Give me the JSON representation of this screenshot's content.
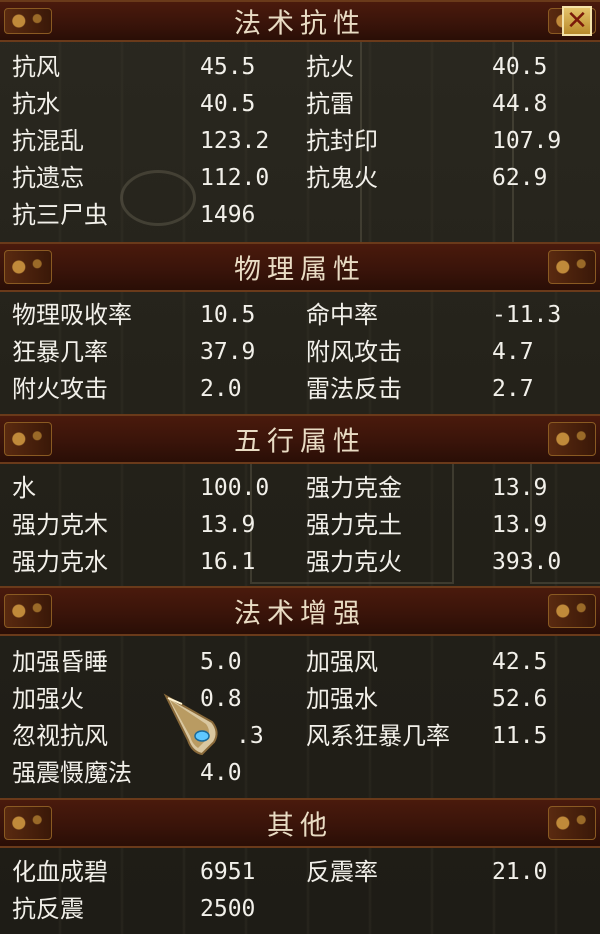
{
  "close_icon": "close-icon",
  "sections": [
    {
      "title": "法术抗性",
      "rows": [
        [
          "抗风",
          "45.5",
          "抗火",
          "40.5"
        ],
        [
          "抗水",
          "40.5",
          "抗雷",
          "44.8"
        ],
        [
          "抗混乱",
          "123.2",
          "抗封印",
          "107.9"
        ],
        [
          "抗遗忘",
          "112.0",
          "抗鬼火",
          "62.9"
        ],
        [
          "抗三尸虫",
          "1496",
          "",
          ""
        ]
      ]
    },
    {
      "title": "物理属性",
      "rows": [
        [
          "物理吸收率",
          "10.5",
          "命中率",
          "-11.3"
        ],
        [
          "狂暴几率",
          "37.9",
          "附风攻击",
          "4.7"
        ],
        [
          "附火攻击",
          "2.0",
          "雷法反击",
          "2.7"
        ]
      ]
    },
    {
      "title": "五行属性",
      "rows": [
        [
          "水",
          "100.0",
          "强力克金",
          "13.9"
        ],
        [
          "强力克木",
          "13.9",
          "强力克土",
          "13.9"
        ],
        [
          "强力克水",
          "16.1",
          "强力克火",
          "393.0"
        ]
      ]
    },
    {
      "title": "法术增强",
      "rows": [
        [
          "加强昏睡",
          "5.0",
          "加强风",
          "42.5"
        ],
        [
          "加强火",
          "0.8",
          "加强水",
          "52.6"
        ],
        [
          "忽视抗风",
          ".3",
          "风系狂暴几率",
          "11.5"
        ],
        [
          "强震慑魔法",
          "4.0",
          "",
          ""
        ]
      ]
    },
    {
      "title": "其他",
      "rows": [
        [
          "化血成碧",
          "6951",
          "反震率",
          "21.0"
        ],
        [
          "抗反震",
          "2500",
          "",
          ""
        ]
      ]
    }
  ]
}
